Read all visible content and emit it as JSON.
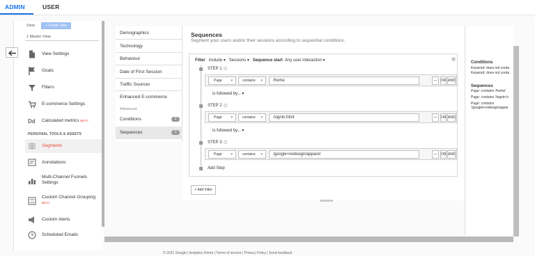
{
  "tabs": {
    "admin": "ADMIN",
    "user": "USER"
  },
  "view": {
    "label": "View",
    "create_button": "+ Create View",
    "master_view": "1 Master View"
  },
  "nav": {
    "items": [
      {
        "label": "View Settings",
        "icon": "document-icon"
      },
      {
        "label": "Goals",
        "icon": "flag-icon"
      },
      {
        "label": "Filters",
        "icon": "filter-icon"
      },
      {
        "label": "E-commerce Settings",
        "icon": "cart-icon"
      },
      {
        "label": "Calculated metrics",
        "beta": "BETA",
        "icon": "dd-icon"
      }
    ],
    "section_header": "PERSONAL TOOLS & ASSETS",
    "tools": [
      {
        "label": "Segments",
        "icon": "segments-icon"
      },
      {
        "label": "Annotations",
        "icon": "annotation-icon"
      },
      {
        "label": "Multi-Channel Funnels Settings",
        "icon": "bar-chart-icon"
      },
      {
        "label": "Custom Channel Grouping",
        "beta": "BETA",
        "icon": "channel-icon"
      },
      {
        "label": "Custom Alerts",
        "icon": "megaphone-icon"
      },
      {
        "label": "Scheduled Emails",
        "icon": "clock-icon"
      }
    ]
  },
  "segnav": {
    "items": [
      "Demographics",
      "Technology",
      "Behaviour",
      "Date of First Session",
      "Traffic Sources",
      "Enhanced E-commerce"
    ],
    "advanced_label": "Advanced",
    "conditions": {
      "label": "Conditions",
      "count": "2"
    },
    "sequences": {
      "label": "Sequences",
      "count": "1"
    }
  },
  "main": {
    "title": "Sequences",
    "subtitle": "Segment your users and/or their sessions according to sequential conditions.",
    "filter": {
      "label": "Filter",
      "include": "Include",
      "sessions": "Sessions",
      "sequence_start_label": "Sequence start",
      "sequence_start_value": "Any user interaction"
    },
    "steps": [
      {
        "label": "STEP 1",
        "dimension": "Page",
        "operator": "contains",
        "value": "/home"
      },
      {
        "label": "STEP 2",
        "dimension": "Page",
        "operator": "contains",
        "value": "/signin.html"
      },
      {
        "label": "STEP 3",
        "dimension": "Page",
        "operator": "contains",
        "value": "/google+redesign/apparel"
      }
    ],
    "followed_by": "is followed by...",
    "minus": "—",
    "or": "OR",
    "and": "AND",
    "add_step": "Add Step",
    "add_filter": "+ Add Filter"
  },
  "summary": {
    "conditions_title": "Conditions",
    "conditions_lines": [
      "Keyword: does not conta",
      "Keyword: does not conta"
    ],
    "sequences_title": "Sequences",
    "sequences_lines": [
      "Page: contains '/home'",
      "Page: contains '/signin.h",
      "Page: contains",
      "'/google+redesign/appar"
    ]
  },
  "footer": "© 2021 Google | Analytics Home | Terms of service | Privacy Policy | Send feedback"
}
